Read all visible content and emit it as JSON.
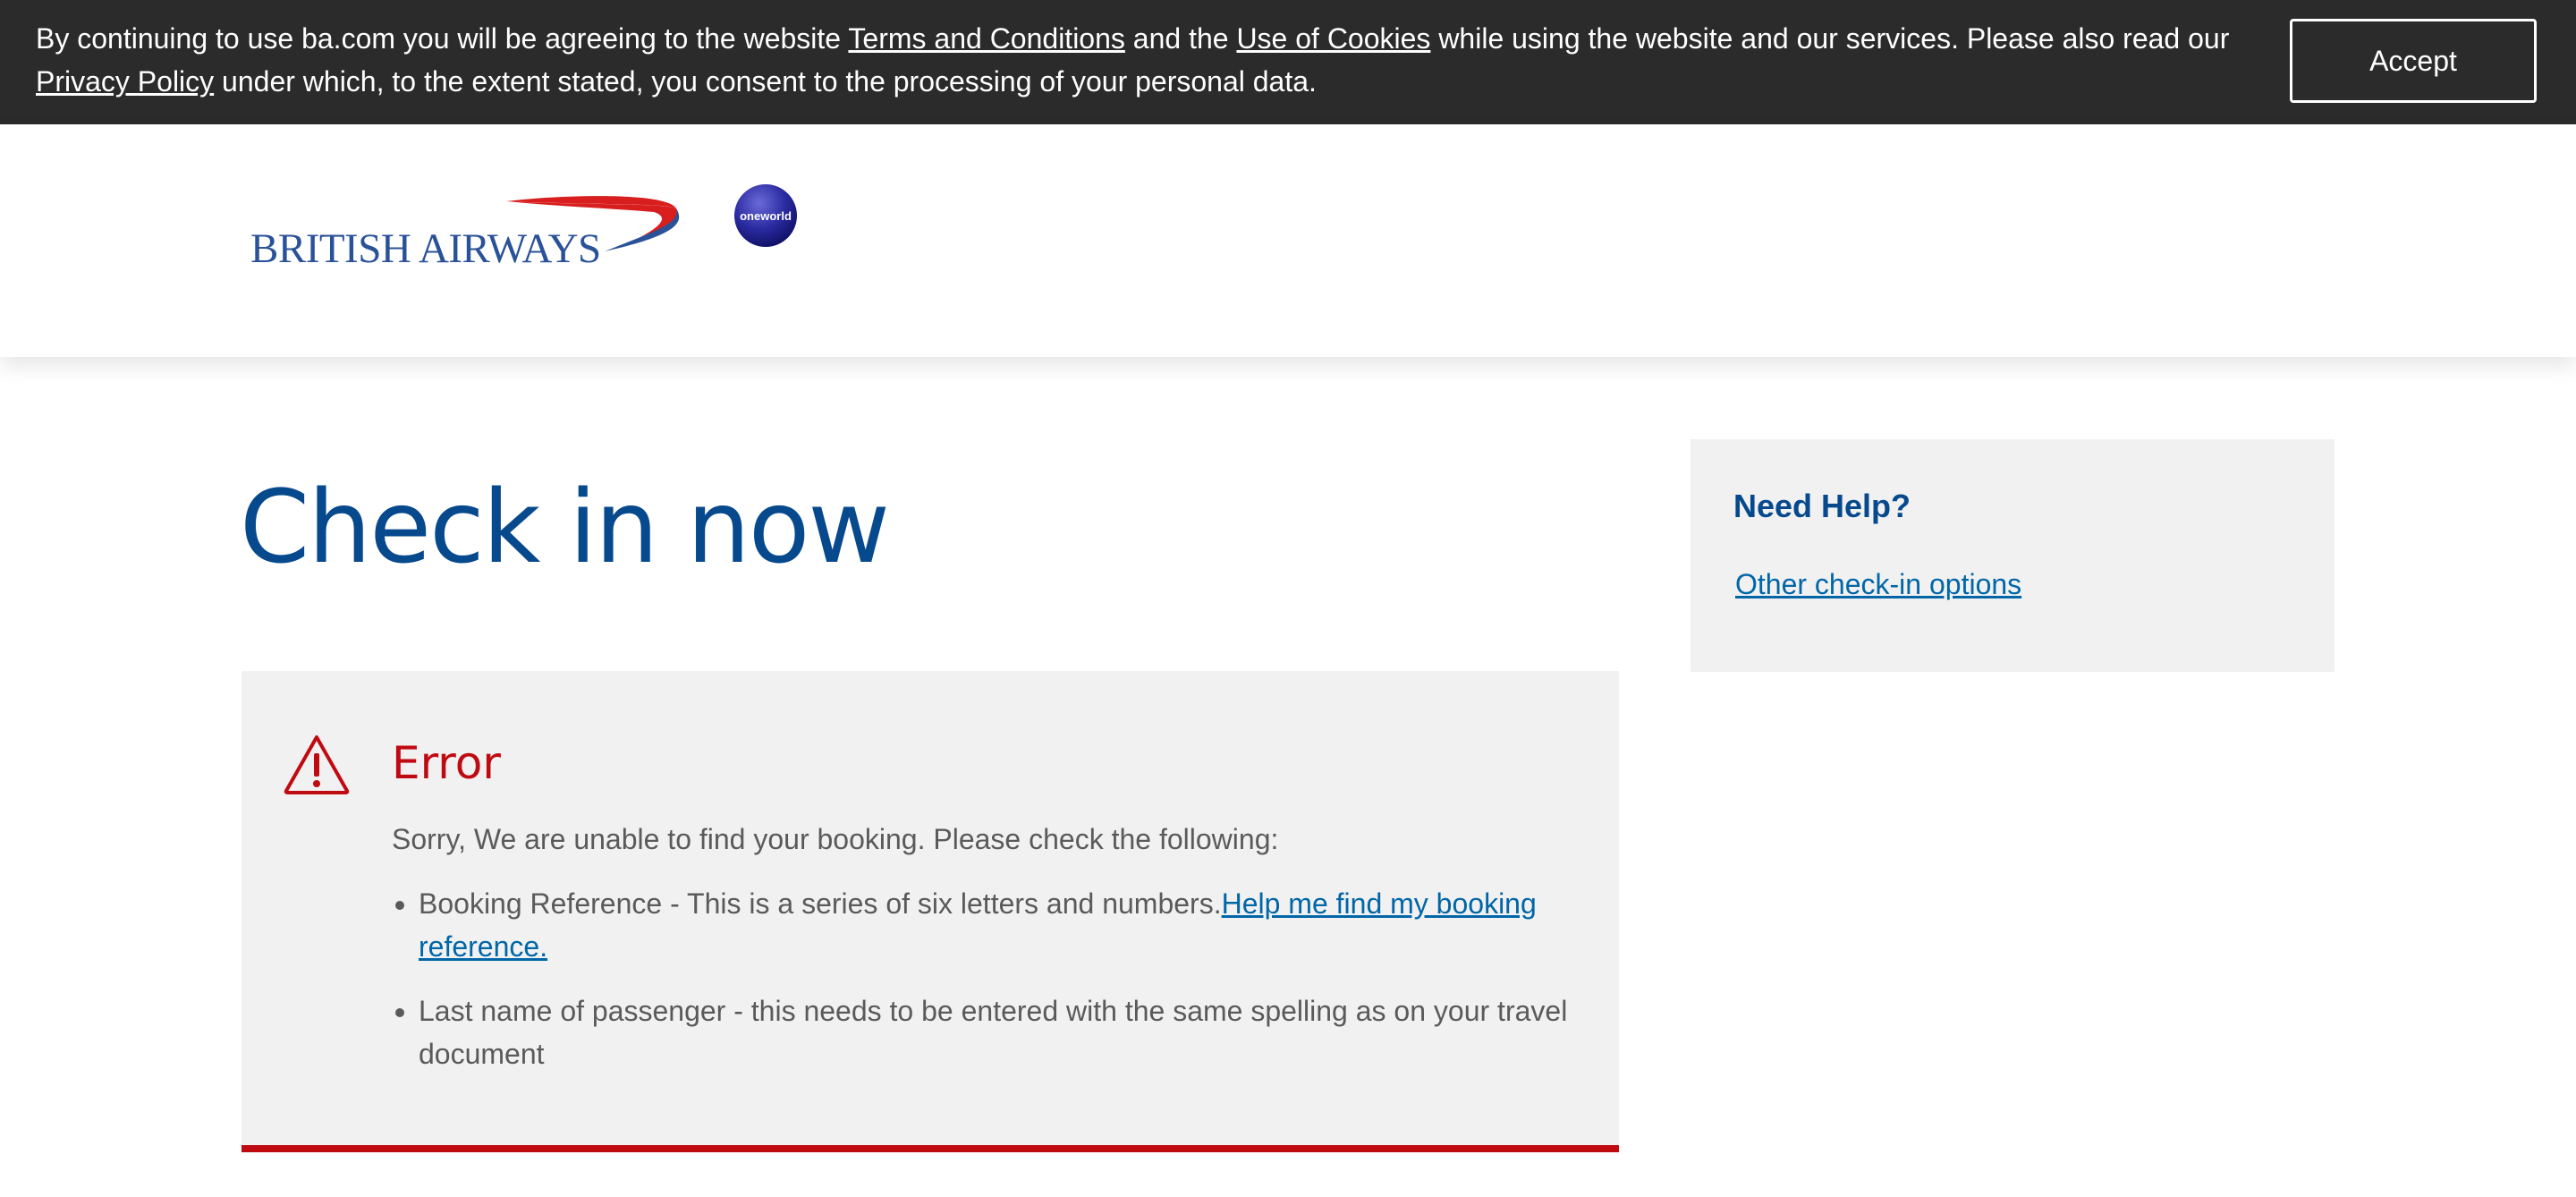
{
  "cookie_banner": {
    "text_before_terms": "By continuing to use ba.com you will be agreeing to the website ",
    "terms_link": "Terms and Conditions",
    "text_between": " and the ",
    "cookies_link": "Use of Cookies",
    "text_after_cookies": " while using the website and our services. Please also read our ",
    "privacy_link": "Privacy Policy",
    "text_end": " under which, to the extent stated, you consent to the processing of your personal data.",
    "accept_label": "Accept"
  },
  "header": {
    "logo_text": "BRITISH AIRWAYS",
    "alliance_text": "oneworld",
    "brand_colors": {
      "blue": "#2a5298",
      "red": "#d81e1e",
      "oneworld": "#1a1a8c"
    }
  },
  "main": {
    "title": "Check in now",
    "error": {
      "icon": "warning-triangle-icon",
      "title": "Error",
      "intro": "Sorry, We are unable to find your booking. Please check the following:",
      "items": [
        {
          "text": "Booking Reference - This is a series of six letters and numbers.",
          "link": "Help me find my booking reference."
        },
        {
          "text": "Last name of passenger - this needs to be entered with the same spelling as on your travel document",
          "link": ""
        }
      ],
      "accent_color": "#c00a12"
    }
  },
  "help": {
    "title": "Need Help?",
    "link": "Other check-in options"
  }
}
